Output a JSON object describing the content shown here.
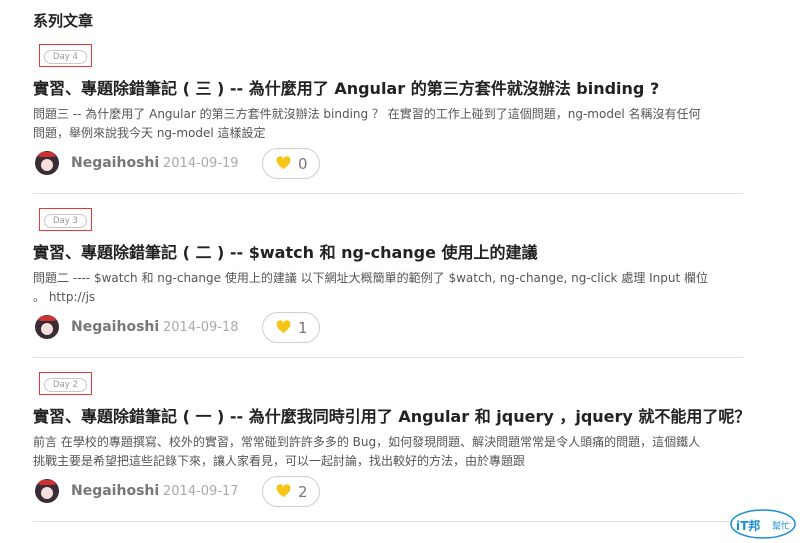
{
  "section_title": "系列文章",
  "articles": [
    {
      "day": "Day 4",
      "title": "實習、專題除錯筆記 ( 三 ) -- 為什麼用了 Angular 的第三方套件就沒辦法 binding ?",
      "desc_line1": "問題三 -- 為什麼用了 Angular 的第三方套件就沒辦法 binding ？ 在實習的工作上碰到了這個問題，ng-model 名稱沒有任何",
      "desc_line2": "問題，舉例來說我今天 ng-model 這樣設定",
      "author": "Negaihoshi",
      "date": "2014-09-19",
      "likes": "0"
    },
    {
      "day": "Day 3",
      "title": "實習、專題除錯筆記 ( 二 ) -- $watch 和 ng-change 使用上的建議",
      "desc_line1": "問題二 ---- $watch 和 ng-change 使用上的建議 以下網址大概簡單的範例了 $watch, ng-change, ng-click 處理 Input 欄位",
      "desc_line2": "。 http://js",
      "author": "Negaihoshi",
      "date": "2014-09-18",
      "likes": "1"
    },
    {
      "day": "Day 2",
      "title": "實習、專題除錯筆記 ( 一 ) -- 為什麼我同時引用了 Angular 和 jquery ，jquery 就不能用了呢？",
      "desc_line1": "前言 在學校的專題撰寫、校外的實習，常常碰到許許多多的 Bug，如何發現問題、解決問題常常是令人頭痛的問題，這個鐵人",
      "desc_line2": "挑戰主要是希望把這些記錄下來，讓人家看見，可以一起討論，找出較好的方法，由於專題跟",
      "author": "Negaihoshi",
      "date": "2014-09-17",
      "likes": "2"
    }
  ],
  "logo": {
    "text_main": "iT邦",
    "text_sub": "幫忙"
  },
  "colors": {
    "day_box": "#e03a3a",
    "heart": "#f5c518",
    "logo_blue": "#1a8fd6"
  }
}
